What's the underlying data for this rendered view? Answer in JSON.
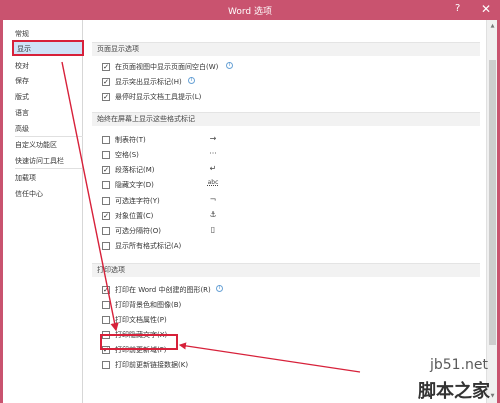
{
  "window": {
    "title": "Word 选项",
    "help_glyph": "?",
    "close_glyph": "✕"
  },
  "sidebar": {
    "items": [
      {
        "label": "常规"
      },
      {
        "label": "显示"
      },
      {
        "label": "校对"
      },
      {
        "label": "保存"
      },
      {
        "label": "版式"
      },
      {
        "label": "语言"
      },
      {
        "label": "高级"
      },
      {
        "label": "自定义功能区"
      },
      {
        "label": "快速访问工具栏"
      },
      {
        "label": "加载项"
      },
      {
        "label": "信任中心"
      }
    ],
    "selected": "显示"
  },
  "page_display": {
    "header": "页面显示选项",
    "options": [
      {
        "label": "在页面视图中显示页面间空白(W)",
        "checked": true,
        "info": true
      },
      {
        "label": "显示突出显示标记(H)",
        "checked": true,
        "info": true
      },
      {
        "label": "悬停时显示文档工具提示(L)",
        "checked": true,
        "info": false
      }
    ]
  },
  "format_marks": {
    "header": "始终在屏幕上显示这些格式标记",
    "options": [
      {
        "label": "制表符(T)",
        "checked": false,
        "symbol": "→"
      },
      {
        "label": "空格(S)",
        "checked": false,
        "symbol": "···"
      },
      {
        "label": "段落标记(M)",
        "checked": true,
        "symbol": "↵"
      },
      {
        "label": "隐藏文字(D)",
        "checked": false,
        "symbol": "abc"
      },
      {
        "label": "可选连字符(Y)",
        "checked": false,
        "symbol": "¬"
      },
      {
        "label": "对象位置(C)",
        "checked": true,
        "symbol": "⚓"
      },
      {
        "label": "可选分隔符(O)",
        "checked": false,
        "symbol": "▯"
      },
      {
        "label": "显示所有格式标记(A)",
        "checked": false,
        "symbol": ""
      }
    ]
  },
  "print_options": {
    "header": "打印选项",
    "options": [
      {
        "label": "打印在 Word 中创建的图形(R)",
        "checked": true,
        "info": true
      },
      {
        "label": "打印背景色和图像(B)",
        "checked": false,
        "info": false
      },
      {
        "label": "打印文档属性(P)",
        "checked": false,
        "info": false
      },
      {
        "label": "打印隐藏文字(X)",
        "checked": false,
        "info": false
      },
      {
        "label": "打印前更新域(F)",
        "checked": true,
        "info": false
      },
      {
        "label": "打印前更新链接数据(K)",
        "checked": false,
        "info": false
      }
    ]
  },
  "watermark": {
    "url": "jb51.net",
    "text": "脚本之家"
  },
  "colors": {
    "titlebar": "#c9536f",
    "highlight": "#d7213a",
    "selected_bg": "#cfe2f7"
  },
  "icons": {
    "info": "info-icon",
    "check": "checkmark-icon"
  }
}
